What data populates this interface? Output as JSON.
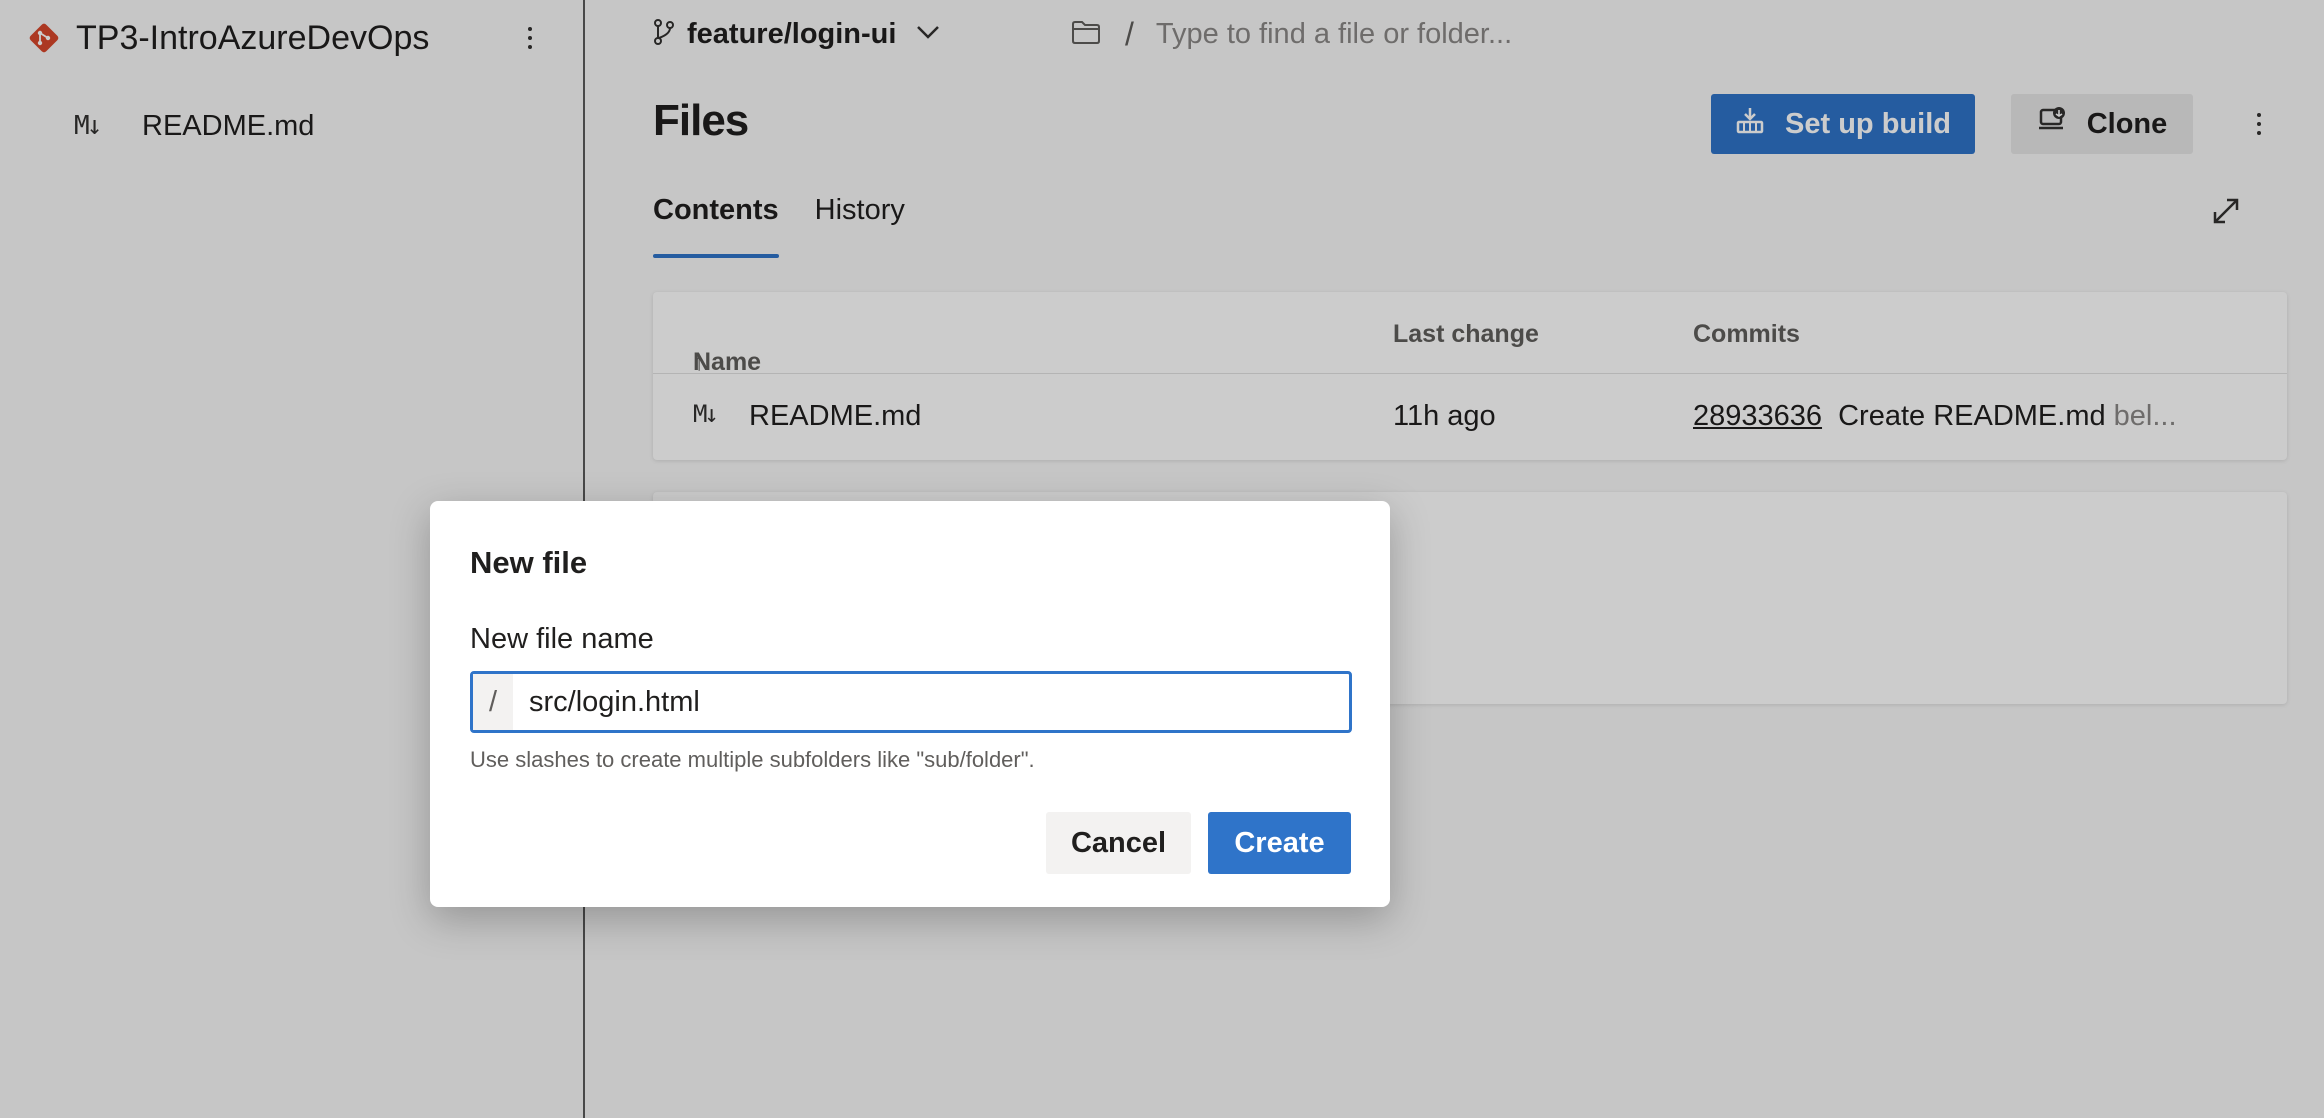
{
  "sidebar": {
    "repo_name": "TP3-IntroAzureDevOps",
    "items": [
      {
        "label": "README.md",
        "icon": "markdown-icon",
        "icon_glyph": "M↓"
      }
    ]
  },
  "header": {
    "branch": "feature/login-ui",
    "path_separator": "/",
    "path_placeholder": "Type to find a file or folder..."
  },
  "main": {
    "title": "Files",
    "setup_build_label": "Set up build",
    "clone_label": "Clone",
    "tabs": [
      {
        "label": "Contents",
        "active": true
      },
      {
        "label": "History",
        "active": false
      }
    ],
    "table": {
      "columns": {
        "name": "Name",
        "sort_arrow": "↑",
        "last_change": "Last change",
        "commits": "Commits"
      },
      "rows": [
        {
          "icon_glyph": "M↓",
          "name": "README.md",
          "last_change": "11h ago",
          "commit_id": "28933636",
          "commit_message": "Create README.md",
          "commit_author": "bel..."
        }
      ]
    }
  },
  "dialog": {
    "title": "New file",
    "field_label": "New file name",
    "prefix": "/",
    "value": "src/login.html",
    "help": "Use slashes to create multiple subfolders like \"sub/folder\".",
    "cancel_label": "Cancel",
    "create_label": "Create"
  },
  "colors": {
    "accent": "#2f74c9",
    "brand_git": "#d8472b",
    "overlay": "rgba(0,0,0,0.2)"
  }
}
